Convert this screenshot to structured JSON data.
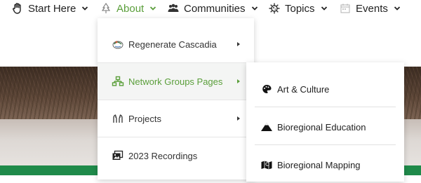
{
  "nav": {
    "items": [
      {
        "label": "Start Here",
        "icon": "hand-icon"
      },
      {
        "label": "About",
        "icon": "tree-icon",
        "active": true
      },
      {
        "label": "Communities",
        "icon": "people-icon"
      },
      {
        "label": "Topics",
        "icon": "virus-icon"
      },
      {
        "label": "Events",
        "icon": "calendar-icon"
      }
    ]
  },
  "about_menu": {
    "items": [
      {
        "label": "Regenerate Cascadia",
        "icon": "globe-icon",
        "has_submenu": true
      },
      {
        "label": "Network Groups Pages",
        "icon": "network-icon",
        "has_submenu": true,
        "highlighted": true
      },
      {
        "label": "Projects",
        "icon": "hands-icon",
        "has_submenu": true
      },
      {
        "label": "2023 Recordings",
        "icon": "photos-icon",
        "has_submenu": false
      }
    ]
  },
  "network_submenu": {
    "items": [
      {
        "label": "Art & Culture",
        "icon": "palette-icon"
      },
      {
        "label": "Bioregional Education",
        "icon": "mountain-icon"
      },
      {
        "label": "Bioregional Mapping",
        "icon": "map-icon"
      }
    ]
  },
  "colors": {
    "accent": "#5a9e3a",
    "text": "#222222",
    "strip": "#1f8a4a"
  }
}
